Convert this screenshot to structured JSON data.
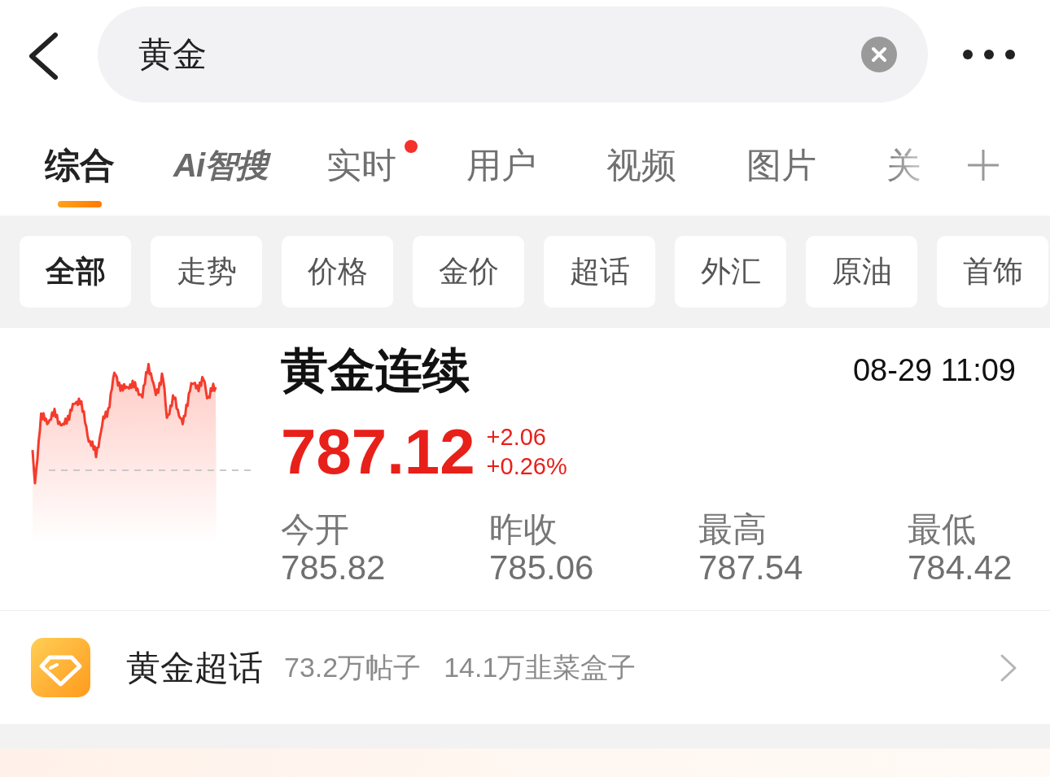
{
  "header": {
    "search": {
      "value": "黄金"
    }
  },
  "tabs": [
    {
      "label": "综合",
      "kind": "text",
      "selected": true,
      "dot": false
    },
    {
      "label": "Ai智搜",
      "kind": "logo",
      "selected": false,
      "dot": false
    },
    {
      "label": "实时",
      "kind": "text",
      "selected": false,
      "dot": true
    },
    {
      "label": "用户",
      "kind": "text",
      "selected": false,
      "dot": false
    },
    {
      "label": "视频",
      "kind": "text",
      "selected": false,
      "dot": false
    },
    {
      "label": "图片",
      "kind": "text",
      "selected": false,
      "dot": false
    },
    {
      "label": "关",
      "kind": "text",
      "selected": false,
      "dot": false
    }
  ],
  "filters": [
    {
      "label": "全部",
      "selected": true
    },
    {
      "label": "走势",
      "selected": false
    },
    {
      "label": "价格",
      "selected": false
    },
    {
      "label": "金价",
      "selected": false
    },
    {
      "label": "超话",
      "selected": false
    },
    {
      "label": "外汇",
      "selected": false
    },
    {
      "label": "原油",
      "selected": false
    },
    {
      "label": "首饰",
      "selected": false
    }
  ],
  "quote": {
    "name": "黄金连续",
    "time": "08-29 11:09",
    "price": "787.12",
    "change": "+2.06",
    "change_percent": "+0.26%",
    "stats": [
      {
        "label": "今开",
        "value": "785.82"
      },
      {
        "label": "昨收",
        "value": "785.06"
      },
      {
        "label": "最高",
        "value": "787.54"
      },
      {
        "label": "最低",
        "value": "784.42"
      }
    ]
  },
  "super_topic": {
    "name": "黄金超话",
    "posts": "73.2万帖子",
    "followers": "14.1万韭菜盒子"
  }
}
